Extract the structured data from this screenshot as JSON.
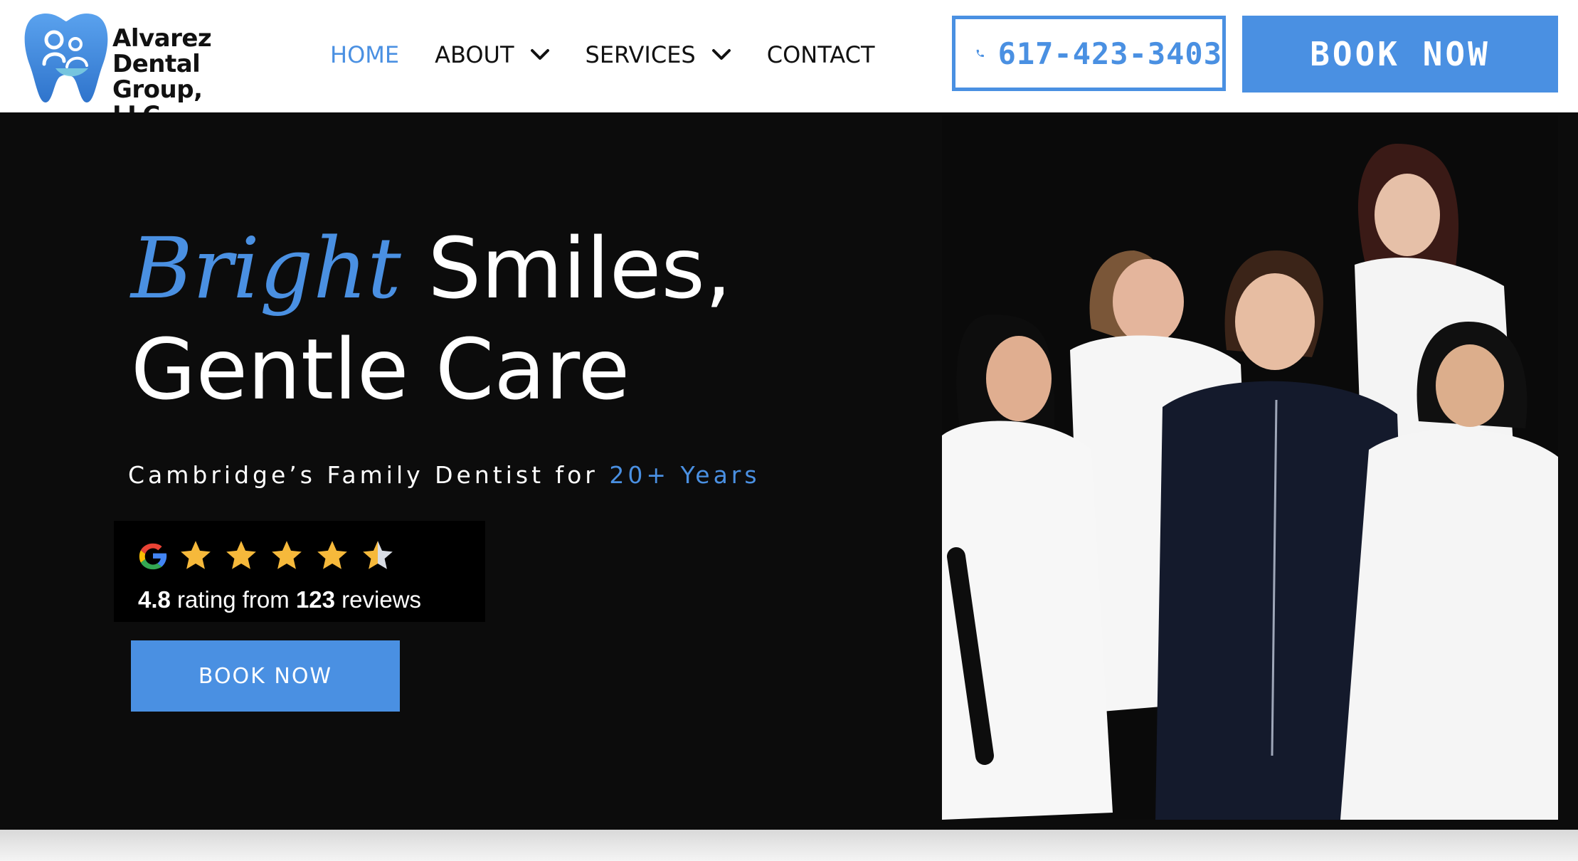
{
  "brand": {
    "name_line1": "Alvarez",
    "name_line2": "Dental",
    "name_line3": "Group, LLC",
    "logo_icon": "tooth-family-icon",
    "colors": {
      "accent": "#4a90e2",
      "text": "#111111",
      "hero_bg": "#0c0c0c"
    }
  },
  "nav": {
    "items": [
      {
        "label": "HOME",
        "active": true,
        "has_dropdown": false
      },
      {
        "label": "ABOUT",
        "active": false,
        "has_dropdown": true
      },
      {
        "label": "SERVICES",
        "active": false,
        "has_dropdown": true
      },
      {
        "label": "CONTACT",
        "active": false,
        "has_dropdown": false
      }
    ],
    "dropdown_icon": "chevron-down-icon"
  },
  "header": {
    "phone": "617-423-3403",
    "phone_icon": "phone-icon",
    "book_label": "BOOK NOW"
  },
  "hero": {
    "title_accent": "Bright",
    "title_rest": " Smiles,",
    "title_line2": "Gentle Care",
    "subtitle_main": "Cambridge’s Family Dentist for ",
    "subtitle_accent": "20+ Years",
    "book_label": "BOOK NOW"
  },
  "rating": {
    "source_icon": "google-icon",
    "stars": 4.5,
    "score": "4.8",
    "text_mid": " rating from ",
    "count": "123",
    "text_end": " reviews"
  }
}
